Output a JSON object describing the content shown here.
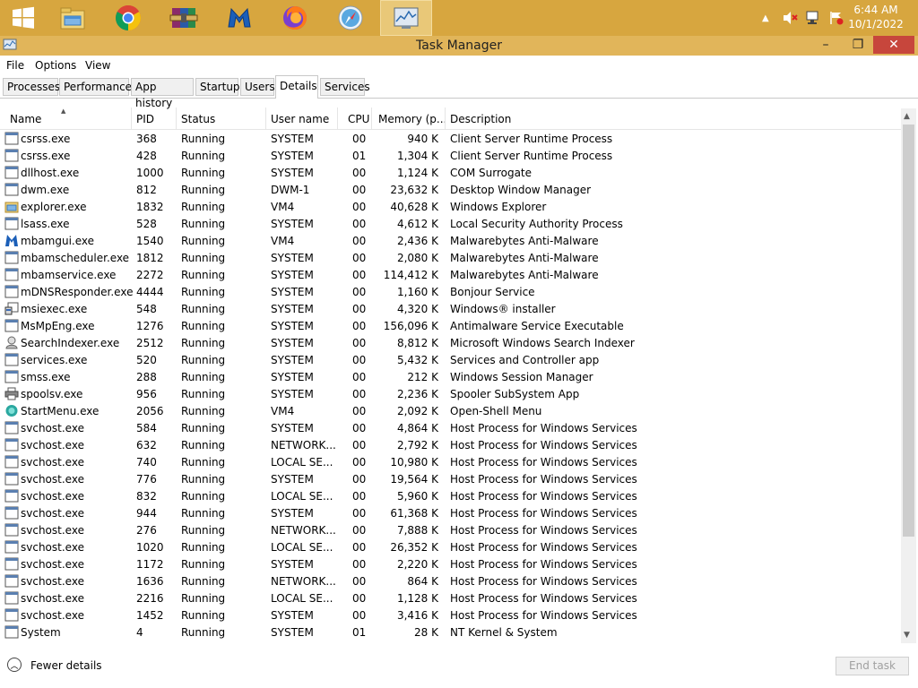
{
  "taskbar": {
    "apps": [
      {
        "name": "start-icon"
      },
      {
        "name": "file-explorer-icon"
      },
      {
        "name": "chrome-icon"
      },
      {
        "name": "winrar-icon"
      },
      {
        "name": "malwarebytes-icon"
      },
      {
        "name": "firefox-icon"
      },
      {
        "name": "safari-icon"
      },
      {
        "name": "task-manager-icon"
      }
    ],
    "clock": {
      "time": "6:44 AM",
      "date": "10/1/2022"
    }
  },
  "window": {
    "title": "Task Manager",
    "controls": {
      "minimize": "–",
      "restore": "❐",
      "close": "✕"
    },
    "menu": [
      "File",
      "Options",
      "View"
    ],
    "tabs": [
      "Processes",
      "Performance",
      "App history",
      "Startup",
      "Users",
      "Details",
      "Services"
    ],
    "selected_tab": "Details"
  },
  "columns": {
    "name": "Name",
    "pid": "PID",
    "status": "Status",
    "user": "User name",
    "cpu": "CPU",
    "memory": "Memory (p...",
    "description": "Description"
  },
  "processes": [
    {
      "icon": "window-icon",
      "name": "csrss.exe",
      "pid": "368",
      "status": "Running",
      "user": "SYSTEM",
      "cpu": "00",
      "memory": "940 K",
      "description": "Client Server Runtime Process"
    },
    {
      "icon": "window-icon",
      "name": "csrss.exe",
      "pid": "428",
      "status": "Running",
      "user": "SYSTEM",
      "cpu": "01",
      "memory": "1,304 K",
      "description": "Client Server Runtime Process"
    },
    {
      "icon": "window-icon",
      "name": "dllhost.exe",
      "pid": "1000",
      "status": "Running",
      "user": "SYSTEM",
      "cpu": "00",
      "memory": "1,124 K",
      "description": "COM Surrogate"
    },
    {
      "icon": "window-icon",
      "name": "dwm.exe",
      "pid": "812",
      "status": "Running",
      "user": "DWM-1",
      "cpu": "00",
      "memory": "23,632 K",
      "description": "Desktop Window Manager"
    },
    {
      "icon": "explorer-icon",
      "name": "explorer.exe",
      "pid": "1832",
      "status": "Running",
      "user": "VM4",
      "cpu": "00",
      "memory": "40,628 K",
      "description": "Windows Explorer"
    },
    {
      "icon": "window-icon",
      "name": "lsass.exe",
      "pid": "528",
      "status": "Running",
      "user": "SYSTEM",
      "cpu": "00",
      "memory": "4,612 K",
      "description": "Local Security Authority Process"
    },
    {
      "icon": "malwarebytes-icon",
      "name": "mbamgui.exe",
      "pid": "1540",
      "status": "Running",
      "user": "VM4",
      "cpu": "00",
      "memory": "2,436 K",
      "description": "Malwarebytes Anti-Malware"
    },
    {
      "icon": "window-icon",
      "name": "mbamscheduler.exe",
      "pid": "1812",
      "status": "Running",
      "user": "SYSTEM",
      "cpu": "00",
      "memory": "2,080 K",
      "description": "Malwarebytes Anti-Malware"
    },
    {
      "icon": "window-icon",
      "name": "mbamservice.exe",
      "pid": "2272",
      "status": "Running",
      "user": "SYSTEM",
      "cpu": "00",
      "memory": "114,412 K",
      "description": "Malwarebytes Anti-Malware"
    },
    {
      "icon": "window-icon",
      "name": "mDNSResponder.exe",
      "pid": "4444",
      "status": "Running",
      "user": "SYSTEM",
      "cpu": "00",
      "memory": "1,160 K",
      "description": "Bonjour Service"
    },
    {
      "icon": "installer-icon",
      "name": "msiexec.exe",
      "pid": "548",
      "status": "Running",
      "user": "SYSTEM",
      "cpu": "00",
      "memory": "4,320 K",
      "description": "Windows® installer"
    },
    {
      "icon": "window-icon",
      "name": "MsMpEng.exe",
      "pid": "1276",
      "status": "Running",
      "user": "SYSTEM",
      "cpu": "00",
      "memory": "156,096 K",
      "description": "Antimalware Service Executable"
    },
    {
      "icon": "search-indexer-icon",
      "name": "SearchIndexer.exe",
      "pid": "2512",
      "status": "Running",
      "user": "SYSTEM",
      "cpu": "00",
      "memory": "8,812 K",
      "description": "Microsoft Windows Search Indexer"
    },
    {
      "icon": "window-icon",
      "name": "services.exe",
      "pid": "520",
      "status": "Running",
      "user": "SYSTEM",
      "cpu": "00",
      "memory": "5,432 K",
      "description": "Services and Controller app"
    },
    {
      "icon": "window-icon",
      "name": "smss.exe",
      "pid": "288",
      "status": "Running",
      "user": "SYSTEM",
      "cpu": "00",
      "memory": "212 K",
      "description": "Windows Session Manager"
    },
    {
      "icon": "printer-icon",
      "name": "spoolsv.exe",
      "pid": "956",
      "status": "Running",
      "user": "SYSTEM",
      "cpu": "00",
      "memory": "2,236 K",
      "description": "Spooler SubSystem App"
    },
    {
      "icon": "openshell-icon",
      "name": "StartMenu.exe",
      "pid": "2056",
      "status": "Running",
      "user": "VM4",
      "cpu": "00",
      "memory": "2,092 K",
      "description": "Open-Shell Menu"
    },
    {
      "icon": "window-icon",
      "name": "svchost.exe",
      "pid": "584",
      "status": "Running",
      "user": "SYSTEM",
      "cpu": "00",
      "memory": "4,864 K",
      "description": "Host Process for Windows Services"
    },
    {
      "icon": "window-icon",
      "name": "svchost.exe",
      "pid": "632",
      "status": "Running",
      "user": "NETWORK...",
      "cpu": "00",
      "memory": "2,792 K",
      "description": "Host Process for Windows Services"
    },
    {
      "icon": "window-icon",
      "name": "svchost.exe",
      "pid": "740",
      "status": "Running",
      "user": "LOCAL SE...",
      "cpu": "00",
      "memory": "10,980 K",
      "description": "Host Process for Windows Services"
    },
    {
      "icon": "window-icon",
      "name": "svchost.exe",
      "pid": "776",
      "status": "Running",
      "user": "SYSTEM",
      "cpu": "00",
      "memory": "19,564 K",
      "description": "Host Process for Windows Services"
    },
    {
      "icon": "window-icon",
      "name": "svchost.exe",
      "pid": "832",
      "status": "Running",
      "user": "LOCAL SE...",
      "cpu": "00",
      "memory": "5,960 K",
      "description": "Host Process for Windows Services"
    },
    {
      "icon": "window-icon",
      "name": "svchost.exe",
      "pid": "944",
      "status": "Running",
      "user": "SYSTEM",
      "cpu": "00",
      "memory": "61,368 K",
      "description": "Host Process for Windows Services"
    },
    {
      "icon": "window-icon",
      "name": "svchost.exe",
      "pid": "276",
      "status": "Running",
      "user": "NETWORK...",
      "cpu": "00",
      "memory": "7,888 K",
      "description": "Host Process for Windows Services"
    },
    {
      "icon": "window-icon",
      "name": "svchost.exe",
      "pid": "1020",
      "status": "Running",
      "user": "LOCAL SE...",
      "cpu": "00",
      "memory": "26,352 K",
      "description": "Host Process for Windows Services"
    },
    {
      "icon": "window-icon",
      "name": "svchost.exe",
      "pid": "1172",
      "status": "Running",
      "user": "SYSTEM",
      "cpu": "00",
      "memory": "2,220 K",
      "description": "Host Process for Windows Services"
    },
    {
      "icon": "window-icon",
      "name": "svchost.exe",
      "pid": "1636",
      "status": "Running",
      "user": "NETWORK...",
      "cpu": "00",
      "memory": "864 K",
      "description": "Host Process for Windows Services"
    },
    {
      "icon": "window-icon",
      "name": "svchost.exe",
      "pid": "2216",
      "status": "Running",
      "user": "LOCAL SE...",
      "cpu": "00",
      "memory": "1,128 K",
      "description": "Host Process for Windows Services"
    },
    {
      "icon": "window-icon",
      "name": "svchost.exe",
      "pid": "1452",
      "status": "Running",
      "user": "SYSTEM",
      "cpu": "00",
      "memory": "3,416 K",
      "description": "Host Process for Windows Services"
    },
    {
      "icon": "window-icon",
      "name": "System",
      "pid": "4",
      "status": "Running",
      "user": "SYSTEM",
      "cpu": "01",
      "memory": "28 K",
      "description": "NT Kernel & System"
    }
  ],
  "footer": {
    "fewer_details": "Fewer details",
    "end_task": "End task"
  },
  "colors": {
    "taskbar": "#d7a63f",
    "titlebar": "#e1b55a",
    "close": "#c7463c",
    "header_sep": "#e5e5e5"
  }
}
